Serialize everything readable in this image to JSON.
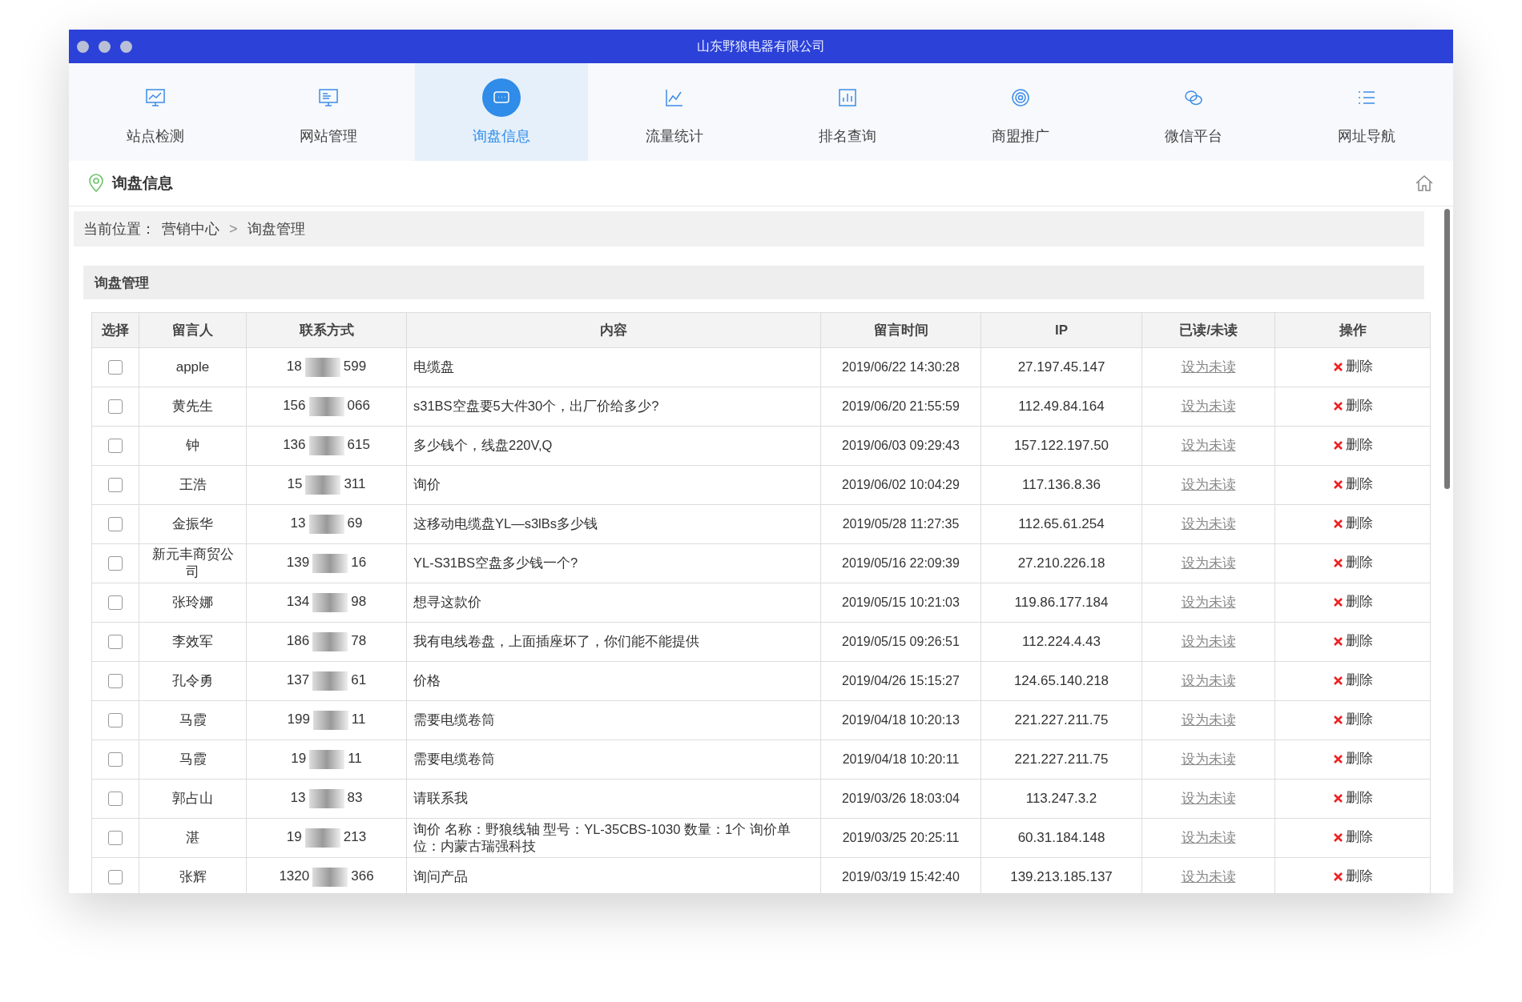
{
  "window": {
    "title": "山东野狼电器有限公司"
  },
  "nav": [
    {
      "label": "站点检测",
      "selected": false
    },
    {
      "label": "网站管理",
      "selected": false
    },
    {
      "label": "询盘信息",
      "selected": true
    },
    {
      "label": "流量统计",
      "selected": false
    },
    {
      "label": "排名查询",
      "selected": false
    },
    {
      "label": "商盟推广",
      "selected": false
    },
    {
      "label": "微信平台",
      "selected": false
    },
    {
      "label": "网址导航",
      "selected": false
    }
  ],
  "page_title": "询盘信息",
  "breadcrumb": {
    "label": "当前位置：",
    "items": [
      "营销中心",
      "询盘管理"
    ],
    "separator": ">"
  },
  "section_title": "询盘管理",
  "table": {
    "columns": [
      "选择",
      "留言人",
      "联系方式",
      "内容",
      "留言时间",
      "IP",
      "已读/未读",
      "操作"
    ],
    "rows": [
      {
        "checked": false,
        "name": "apple",
        "phone_start": "18",
        "phone_end": "599",
        "content": "电缆盘",
        "time": "2019/06/22 14:30:28",
        "ip": "27.197.45.147",
        "read_action": "设为未读",
        "delete": "删除"
      },
      {
        "checked": false,
        "name": "黄先生",
        "phone_start": "156",
        "phone_end": "066",
        "content": "s31BS空盘要5大件30个，出厂价给多少?",
        "time": "2019/06/20 21:55:59",
        "ip": "112.49.84.164",
        "read_action": "设为未读",
        "delete": "删除"
      },
      {
        "checked": false,
        "name": "钟",
        "phone_start": "136",
        "phone_end": "615",
        "content": "多少钱个，线盘220V,Q",
        "time": "2019/06/03 09:29:43",
        "ip": "157.122.197.50",
        "read_action": "设为未读",
        "delete": "删除"
      },
      {
        "checked": false,
        "name": "王浩",
        "phone_start": "15",
        "phone_end": "311",
        "content": "询价",
        "time": "2019/06/02 10:04:29",
        "ip": "117.136.8.36",
        "read_action": "设为未读",
        "delete": "删除"
      },
      {
        "checked": false,
        "name": "金振华",
        "phone_start": "13",
        "phone_end": "69",
        "content": "这移动电缆盘YL—s3lBs多少钱",
        "time": "2019/05/28 11:27:35",
        "ip": "112.65.61.254",
        "read_action": "设为未读",
        "delete": "删除"
      },
      {
        "checked": false,
        "name": "新元丰商贸公司",
        "phone_start": "139",
        "phone_end": "16",
        "content": "YL-S31BS空盘多少钱一个?",
        "time": "2019/05/16 22:09:39",
        "ip": "27.210.226.18",
        "read_action": "设为未读",
        "delete": "删除"
      },
      {
        "checked": false,
        "name": "张玲娜",
        "phone_start": "134",
        "phone_end": "98",
        "content": "想寻这款价",
        "time": "2019/05/15 10:21:03",
        "ip": "119.86.177.184",
        "read_action": "设为未读",
        "delete": "删除"
      },
      {
        "checked": false,
        "name": "李效军",
        "phone_start": "186",
        "phone_end": "78",
        "content": "我有电线卷盘，上面插座坏了，你们能不能提供",
        "time": "2019/05/15 09:26:51",
        "ip": "112.224.4.43",
        "read_action": "设为未读",
        "delete": "删除"
      },
      {
        "checked": false,
        "name": "孔令勇",
        "phone_start": "137",
        "phone_end": "61",
        "content": "价格",
        "time": "2019/04/26 15:15:27",
        "ip": "124.65.140.218",
        "read_action": "设为未读",
        "delete": "删除"
      },
      {
        "checked": false,
        "name": "马霞",
        "phone_start": "199",
        "phone_end": "11",
        "content": "需要电缆卷筒",
        "time": "2019/04/18 10:20:13",
        "ip": "221.227.211.75",
        "read_action": "设为未读",
        "delete": "删除"
      },
      {
        "checked": false,
        "name": "马霞",
        "phone_start": "19",
        "phone_end": "11",
        "content": "需要电缆卷筒",
        "time": "2019/04/18 10:20:11",
        "ip": "221.227.211.75",
        "read_action": "设为未读",
        "delete": "删除"
      },
      {
        "checked": false,
        "name": "郭占山",
        "phone_start": "13",
        "phone_end": "83",
        "content": "请联系我",
        "time": "2019/03/26 18:03:04",
        "ip": "113.247.3.2",
        "read_action": "设为未读",
        "delete": "删除"
      },
      {
        "checked": false,
        "name": "湛",
        "phone_start": "19",
        "phone_end": "213",
        "content": "询价 名称：野狼线轴 型号：YL-35CBS-1030 数量：1个 询价单位：内蒙古瑞强科技",
        "time": "2019/03/25 20:25:11",
        "ip": "60.31.184.148",
        "read_action": "设为未读",
        "delete": "删除"
      },
      {
        "checked": false,
        "name": "张辉",
        "phone_start": "1320",
        "phone_end": "366",
        "content": "询问产品",
        "time": "2019/03/19 15:42:40",
        "ip": "139.213.185.137",
        "read_action": "设为未读",
        "delete": "删除"
      }
    ]
  }
}
